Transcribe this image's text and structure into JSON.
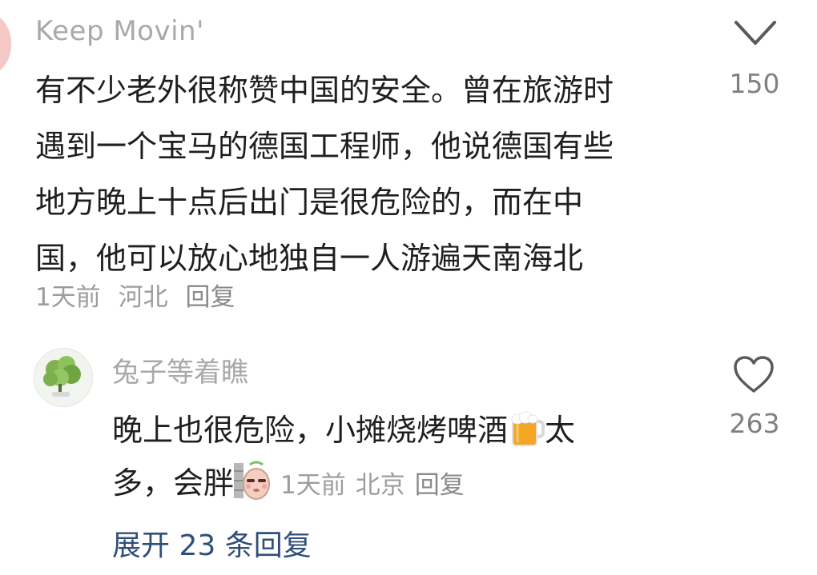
{
  "comment": {
    "author": "Keep Movin'",
    "lines": [
      "有不少老外很称赞中国的安全。曾在旅游时",
      "遇到一个宝马的德国工程师，他说德国有些",
      "地方晚上十点后出门是很危险的，而在中",
      "国，他可以放心地独自一人游遍天南海北"
    ],
    "time": "1天前",
    "location": "河北",
    "reply_label": "回复",
    "like_icon": "heart-outline-icon",
    "likes": "150"
  },
  "reply": {
    "author": "兔子等着瞧",
    "line1_text": "晚上也很危险，小摊烧烤啤酒",
    "line1_emoji": "beer-mug-emoji",
    "line1_after": "太",
    "line2_text": "多，会胖",
    "line2_emoji": "peeking-face-emoji",
    "time": "1天前",
    "location": "北京",
    "reply_label": "回复",
    "like_icon": "heart-outline-icon",
    "likes": "263"
  },
  "expand_replies": {
    "label": "展开 23 条回复"
  },
  "colors": {
    "text": "#1f1f1f",
    "meta": "#9d9d9d",
    "author": "#a9a9a9",
    "link": "#2e4f7a"
  }
}
